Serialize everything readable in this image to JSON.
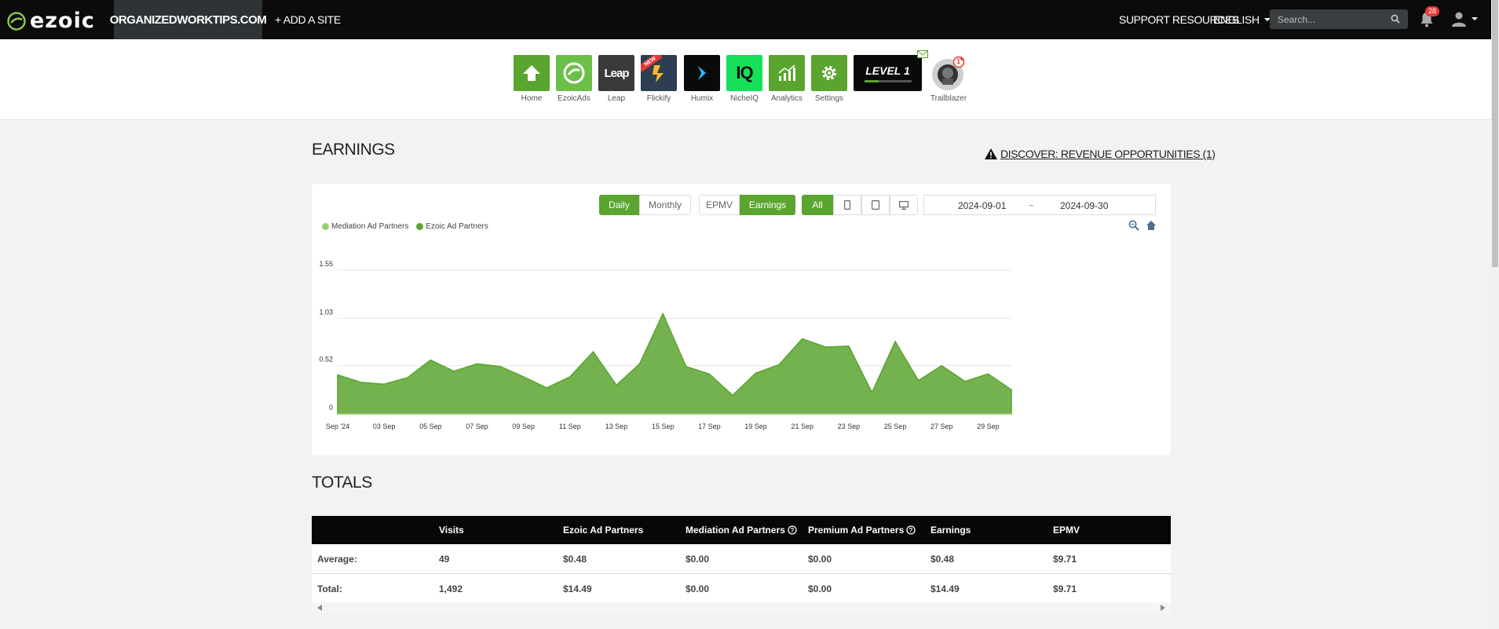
{
  "topbar": {
    "logo": "ezoic",
    "site_name": "ORGANIZEDWORKTIPS.COM",
    "add_site": "+ ADD A SITE",
    "support": "SUPPORT RESOURCES",
    "language": "ENGLISH",
    "search_placeholder": "Search...",
    "notifications_count": "28"
  },
  "apps": [
    {
      "label": "Home",
      "icon": "home-icon"
    },
    {
      "label": "EzoicAds",
      "icon": "ezoicads-icon"
    },
    {
      "label": "Leap",
      "icon": "leap-icon",
      "tile_text": "Leap"
    },
    {
      "label": "Flickify",
      "icon": "flickify-icon",
      "ribbon": "NEW"
    },
    {
      "label": "Humix",
      "icon": "humix-icon"
    },
    {
      "label": "NicheIQ",
      "icon": "nicheiq-icon",
      "tile_text": "IQ"
    },
    {
      "label": "Analytics",
      "icon": "analytics-icon"
    },
    {
      "label": "Settings",
      "icon": "gear-icon"
    },
    {
      "label": "",
      "icon": "level-icon",
      "tile_text": "LEVEL 1"
    },
    {
      "label": "Trailblazer",
      "icon": "trailblazer-icon",
      "badge": "1"
    }
  ],
  "earnings": {
    "title": "EARNINGS",
    "discover": "DISCOVER: REVENUE OPPORTUNITIES (1)",
    "buttons": {
      "daily": "Daily",
      "monthly": "Monthly",
      "epmv": "EPMV",
      "earnings": "Earnings",
      "all": "All"
    },
    "date_start": "2024-09-01",
    "date_sep": "~",
    "date_end": "2024-09-30"
  },
  "chart_data": {
    "type": "area",
    "title": "",
    "legend": [
      "Mediation Ad Partners",
      "Ezoic Ad Partners"
    ],
    "legend_position": "top-left",
    "grid": true,
    "colors": {
      "Mediation Ad Partners": "#9ccf74",
      "Ezoic Ad Partners": "#5aa52f"
    },
    "y_ticks": [
      "0",
      "0.52",
      "1.03",
      "1.55"
    ],
    "ylim": [
      0,
      1.55
    ],
    "x_ticks": [
      "Sep '24",
      "03 Sep",
      "05 Sep",
      "07 Sep",
      "09 Sep",
      "11 Sep",
      "13 Sep",
      "15 Sep",
      "17 Sep",
      "19 Sep",
      "21 Sep",
      "23 Sep",
      "25 Sep",
      "27 Sep",
      "29 Sep"
    ],
    "x": [
      "2024-09-01",
      "2024-09-02",
      "2024-09-03",
      "2024-09-04",
      "2024-09-05",
      "2024-09-06",
      "2024-09-07",
      "2024-09-08",
      "2024-09-09",
      "2024-09-10",
      "2024-09-11",
      "2024-09-12",
      "2024-09-13",
      "2024-09-14",
      "2024-09-15",
      "2024-09-16",
      "2024-09-17",
      "2024-09-18",
      "2024-09-19",
      "2024-09-20",
      "2024-09-21",
      "2024-09-22",
      "2024-09-23",
      "2024-09-24",
      "2024-09-25",
      "2024-09-26",
      "2024-09-27",
      "2024-09-28",
      "2024-09-29",
      "2024-09-30"
    ],
    "series": [
      {
        "name": "Mediation Ad Partners",
        "values": [
          0,
          0,
          0,
          0,
          0,
          0,
          0,
          0,
          0,
          0,
          0,
          0,
          0,
          0,
          0,
          0,
          0,
          0,
          0,
          0,
          0,
          0,
          0,
          0,
          0,
          0,
          0,
          0,
          0,
          0
        ]
      },
      {
        "name": "Ezoic Ad Partners",
        "values": [
          0.42,
          0.34,
          0.32,
          0.39,
          0.58,
          0.46,
          0.54,
          0.51,
          0.4,
          0.28,
          0.4,
          0.67,
          0.31,
          0.54,
          1.08,
          0.51,
          0.43,
          0.2,
          0.44,
          0.53,
          0.81,
          0.72,
          0.73,
          0.23,
          0.78,
          0.36,
          0.52,
          0.35,
          0.43,
          0.26
        ]
      }
    ]
  },
  "totals": {
    "title": "TOTALS",
    "columns": [
      "",
      "Visits",
      "Ezoic Ad Partners",
      "Mediation Ad Partners",
      "Premium Ad Partners",
      "Earnings",
      "EPMV"
    ],
    "rows": [
      [
        "Average:",
        "49",
        "$0.48",
        "$0.00",
        "$0.00",
        "$0.48",
        "$9.71"
      ],
      [
        "Total:",
        "1,492",
        "$14.49",
        "$0.00",
        "$0.00",
        "$14.49",
        "$9.71"
      ]
    ]
  }
}
